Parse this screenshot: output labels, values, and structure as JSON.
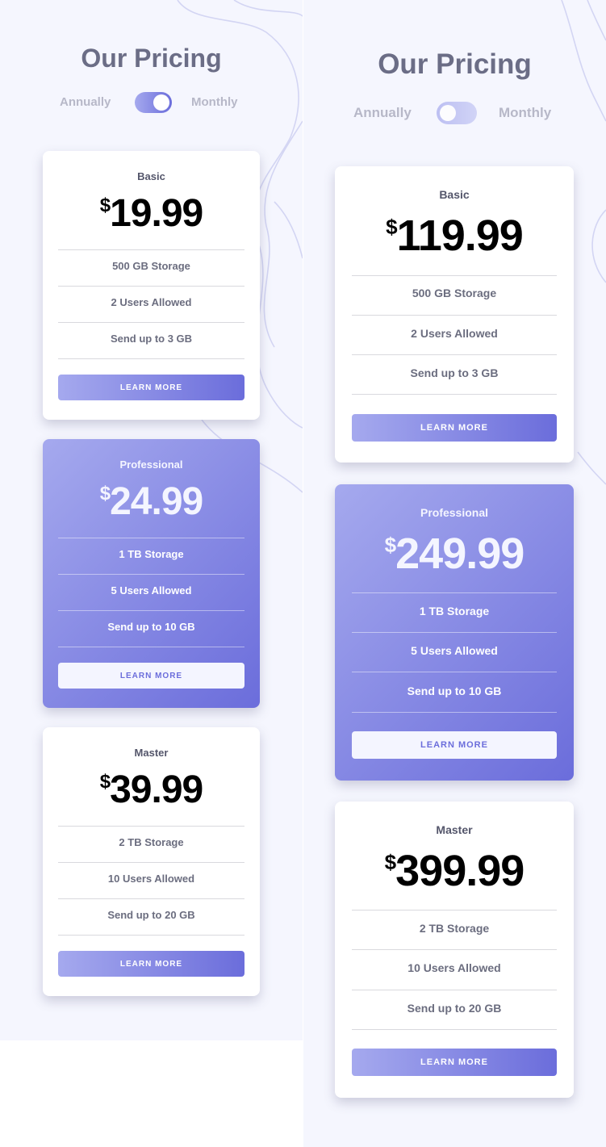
{
  "header": {
    "title": "Our Pricing",
    "toggle_left_label": "Annually",
    "toggle_right_label": "Monthly"
  },
  "colors": {
    "accent_start": "#a5a9ee",
    "accent_end": "#6b6ddb",
    "background": "#f5f6fe",
    "title": "#6b6d86"
  },
  "left_view": {
    "toggle_state": "monthly",
    "plans": [
      {
        "name": "Basic",
        "currency": "$",
        "price": "19.99",
        "features": [
          "500 GB Storage",
          "2 Users Allowed",
          "Send up to 3 GB"
        ],
        "button": "LEARN MORE"
      },
      {
        "name": "Professional",
        "currency": "$",
        "price": "24.99",
        "features": [
          "1 TB Storage",
          "5 Users Allowed",
          "Send up to 10 GB"
        ],
        "button": "LEARN MORE"
      },
      {
        "name": "Master",
        "currency": "$",
        "price": "39.99",
        "features": [
          "2 TB Storage",
          "10 Users Allowed",
          "Send up to 20 GB"
        ],
        "button": "LEARN MORE"
      }
    ]
  },
  "right_view": {
    "toggle_state": "annually",
    "plans": [
      {
        "name": "Basic",
        "currency": "$",
        "price": "119.99",
        "features": [
          "500 GB Storage",
          "2 Users Allowed",
          "Send up to 3 GB"
        ],
        "button": "LEARN MORE"
      },
      {
        "name": "Professional",
        "currency": "$",
        "price": "249.99",
        "features": [
          "1 TB Storage",
          "5 Users Allowed",
          "Send up to 10 GB"
        ],
        "button": "LEARN MORE"
      },
      {
        "name": "Master",
        "currency": "$",
        "price": "399.99",
        "features": [
          "2 TB Storage",
          "10 Users Allowed",
          "Send up to 20 GB"
        ],
        "button": "LEARN MORE"
      }
    ]
  }
}
